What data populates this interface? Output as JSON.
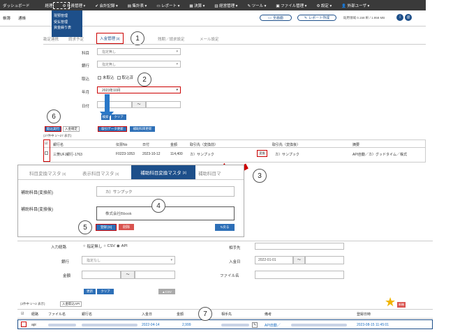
{
  "topbar": {
    "items": [
      "ダッシュボード",
      "経理",
      "社員管理",
      "会計記録",
      "集計表",
      "レポート",
      "決算",
      "経営管理",
      "ツール",
      "ファイル管理",
      "設定",
      "外部ユーザ"
    ]
  },
  "dropdown": {
    "items": [
      "現預管理",
      "受払管理",
      "資金繰り表"
    ]
  },
  "subbar": {
    "left_items": [
      "帳簿",
      "通帳"
    ],
    "btn_fullscreen": "全画面",
    "btn_report": "レポート作成",
    "usage": "既用領域 0.158 軒 / 1.958 MB"
  },
  "tabs1": {
    "prefix": "勘定連携",
    "truncated": "請求予定",
    "active": "入金管理",
    "active_count": "[3]",
    "others": [
      "残期／請求設定",
      "メール設定"
    ]
  },
  "form1": {
    "subject_label": "科目",
    "subject_value": "指定無し",
    "bank_label": "銀行",
    "bank_value": "指定無し",
    "status_label": "取込",
    "status_opt1": "未取込",
    "status_opt2": "取込済",
    "month_label": "年月",
    "month_value": "2023年10月",
    "date_label": "日付",
    "date_sep": "〜",
    "btn_search": "検索",
    "btn_clear": "クリア"
  },
  "table1": {
    "btn_import": "取込実行",
    "btn_monthly": "入金確定",
    "btn_update": "取引データ更新",
    "btn_assist": "補助科目更新",
    "count": "(27件中 1〜27 表示)",
    "headers": [
      "",
      "銀行名",
      "伝票No",
      "日付",
      "金額",
      "取引先（変換前）",
      "取引先（変換後）",
      "摘要"
    ],
    "row": [
      "",
      "三菱UFJ銀行-1763",
      "F0223-1053",
      "2023-10-12",
      "114,400",
      "カ）サンプック",
      "変換",
      "カ）サンプック",
      "API自動／カ）グッドタイム／株式"
    ]
  },
  "panel2": {
    "tabs": [
      "科目変換マスタ",
      "表示科目マスタ",
      "補助科目変換マスタ",
      "補助科目マ"
    ],
    "tab_counts": [
      "[0]",
      "[0]",
      "[3]",
      ""
    ],
    "before_label": "補助科目(変換前)",
    "before_value": "カ）サンプック",
    "after_label": "補助科目(変換後)",
    "after_value": "株式会社Bbook",
    "btn_save": "登録 [D]",
    "btn_delete": "削除",
    "btn_back": "戻る"
  },
  "panel3": {
    "route_label": "入力経路",
    "route_opts": [
      "指定無し",
      "CSV",
      "API"
    ],
    "partner_label": "相手先",
    "bank_label": "銀行",
    "bank_value": "指定なし",
    "date_label": "入金日",
    "date_from": "2022-01-01",
    "date_sep": "〜",
    "amount_label": "金額",
    "amount_sep": "〜",
    "file_label": "ファイル名",
    "btn_update": "更新",
    "btn_clear": "クリア",
    "btn_csv": "CSV",
    "count": "(2件中 1〜2 表示)",
    "btn_import_api": "入金取込API",
    "headers": [
      "",
      "経路",
      "ファイル名",
      "銀行名",
      "入金日",
      "金額",
      "相手先",
      "",
      "備考",
      "登録日時"
    ],
    "row": [
      "",
      "api",
      "",
      "",
      "2022-04-14",
      "2,999",
      "",
      "",
      "API自動／",
      "2023-08-15 11:45:01"
    ],
    "badge_new": "新機"
  },
  "callouts": [
    "1",
    "2",
    "3",
    "4",
    "5",
    "6",
    "7"
  ],
  "colors": {
    "primary": "#1d4f8a",
    "accent": "#c00000",
    "button": "#2d6fb7"
  }
}
